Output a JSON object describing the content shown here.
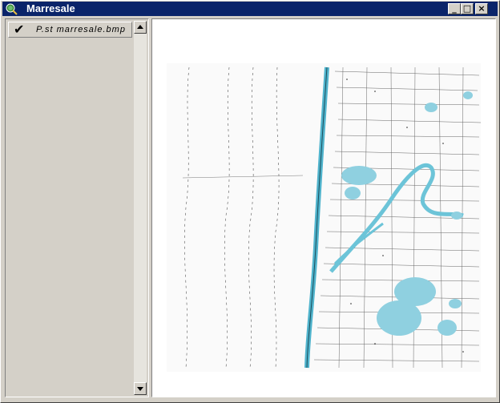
{
  "window": {
    "title": "Marresale",
    "icon": "magnifier-globe-icon",
    "controls": {
      "minimize": "_",
      "maximize": "□",
      "close": "×"
    }
  },
  "toc": {
    "layers": [
      {
        "label": "P.st marresale.bmp",
        "visible": true,
        "check_glyph": "✔"
      }
    ]
  },
  "map": {
    "image_name": "P.st marresale.bmp",
    "water_color": "#8fd0e0",
    "ink_color": "#222222",
    "title_bar_color": "#0a246a"
  }
}
